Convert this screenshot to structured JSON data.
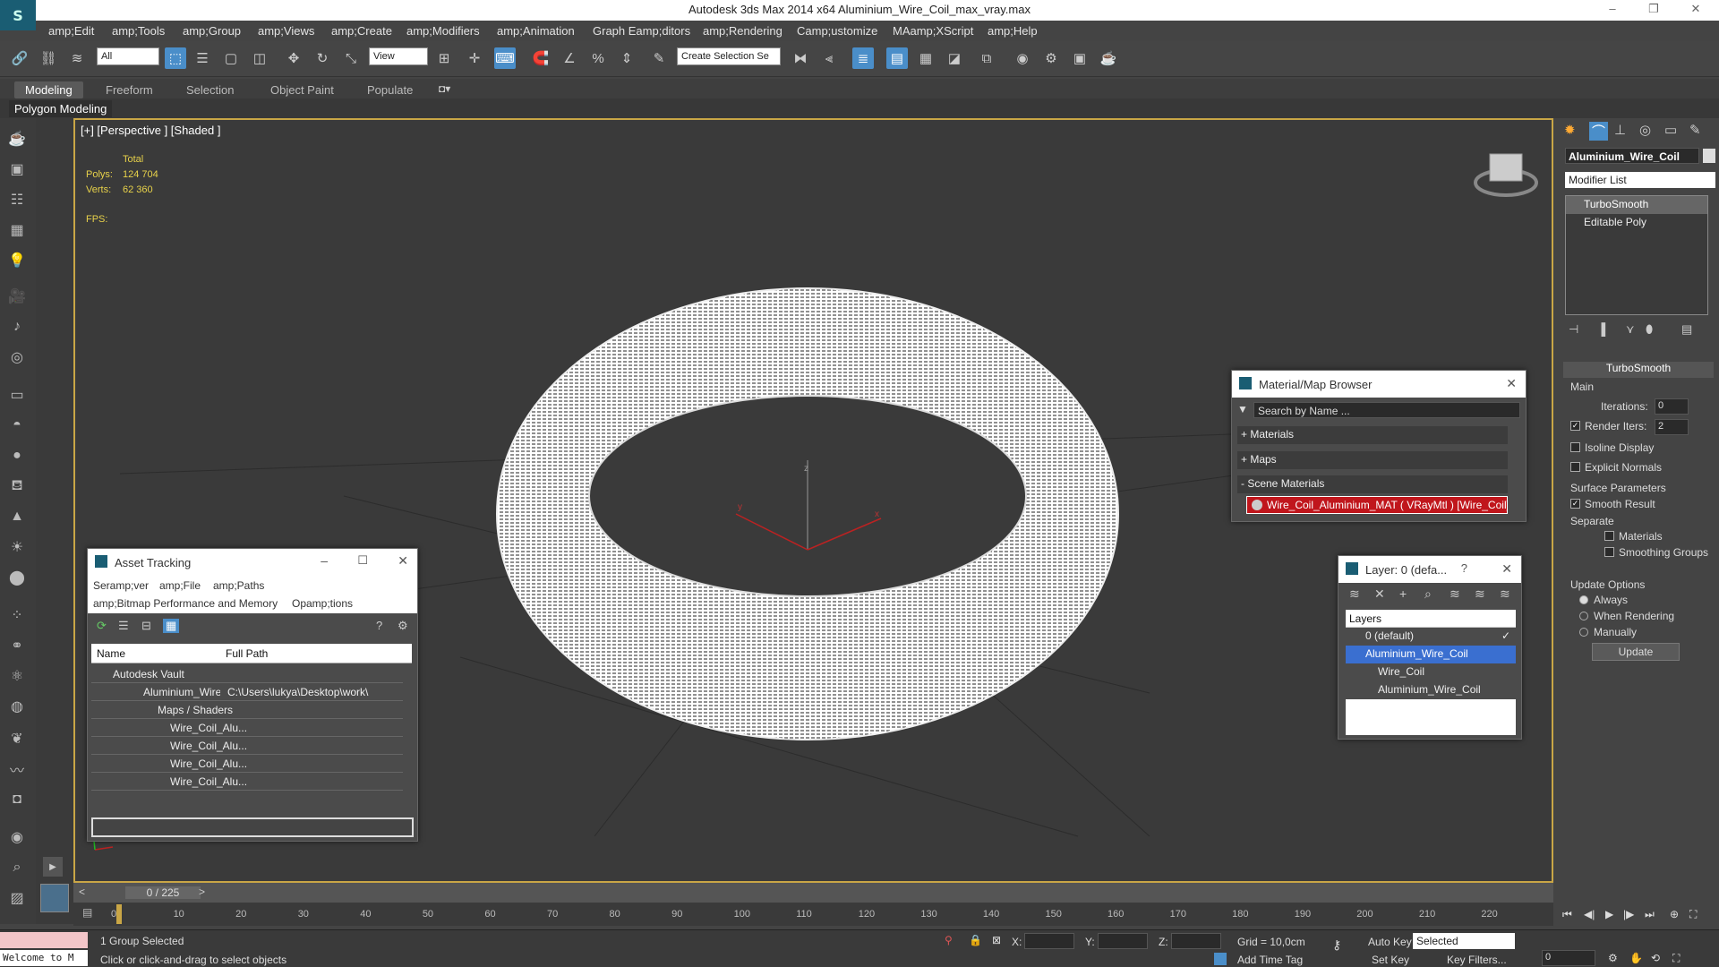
{
  "window": {
    "title": "Autodesk 3ds Max  2014 x64     Aluminium_Wire_Coil_max_vray.max",
    "app_icon": "3ds-max-logo-icon",
    "controls": [
      "–",
      "❐",
      "✕"
    ]
  },
  "menu": [
    "amp;Edit",
    "amp;Tools",
    "amp;Group",
    "amp;Views",
    "amp;Create",
    "amp;Modifiers",
    "amp;Animation",
    "Graph Eamp;ditors",
    "amp;Rendering",
    "Camp;ustomize",
    "MAamp;XScript",
    "amp;Help"
  ],
  "toolbar": {
    "selection_filter": "All",
    "reference_coord": "View",
    "named_selection": "Create Selection Se"
  },
  "ribbon": {
    "tabs": [
      "Modeling",
      "Freeform",
      "Selection",
      "Object Paint",
      "Populate"
    ],
    "active_tab": "Modeling",
    "sub_label": "Polygon Modeling"
  },
  "viewport": {
    "label": "[+] [Perspective ] [Shaded ]",
    "stats": {
      "total_label": "Total",
      "polys_label": "Polys:",
      "polys_value": "124 704",
      "verts_label": "Verts:",
      "verts_value": "62 360",
      "fps_label": "FPS:"
    },
    "axis_x": "x",
    "axis_y": "y",
    "axis_z": "z"
  },
  "command_panel": {
    "object_name": "Aluminium_Wire_Coil",
    "modifier_list": "Modifier List",
    "stack": [
      "TurboSmooth",
      "Editable Poly"
    ],
    "rollout_title": "TurboSmooth",
    "main_label": "Main",
    "iterations_label": "Iterations:",
    "iterations_value": "0",
    "render_iters_label": "Render Iters:",
    "render_iters_value": "2",
    "render_iters_checked": true,
    "isoline_label": "Isoline Display",
    "explicit_normals_label": "Explicit Normals",
    "surface_params_label": "Surface Parameters",
    "smooth_result_label": "Smooth Result",
    "smooth_result_checked": true,
    "separate_label": "Separate",
    "materials_label": "Materials",
    "smoothing_groups_label": "Smoothing Groups",
    "update_options_label": "Update Options",
    "always_label": "Always",
    "when_rendering_label": "When Rendering",
    "manually_label": "Manually",
    "update_button": "Update"
  },
  "material_browser": {
    "title": "Material/Map Browser",
    "search_placeholder": "Search by Name ...",
    "sections": [
      "+ Materials",
      "+ Maps",
      "- Scene Materials"
    ],
    "scene_material": "Wire_Coil_Aluminium_MAT  ( VRayMtl )  [Wire_Coil]"
  },
  "layer_window": {
    "title": "Layer: 0 (defa...",
    "help": "?",
    "header": "Layers",
    "rows": [
      "0 (default)",
      "Aluminium_Wire_Coil",
      "Wire_Coil",
      "Aluminium_Wire_Coil"
    ]
  },
  "asset_tracking": {
    "title": "Asset Tracking",
    "menu": [
      "Seramp;ver",
      "amp;File",
      "amp;Paths",
      "amp;Bitmap Performance and Memory",
      "Opamp;tions"
    ],
    "col_name": "Name",
    "col_path": "Full Path",
    "rows": [
      {
        "name": "Autodesk Vault",
        "path": ""
      },
      {
        "name": "Aluminium_Wire_C...",
        "path": "C:\\Users\\lukya\\Desktop\\work\\"
      },
      {
        "name": "Maps / Shaders",
        "path": ""
      },
      {
        "name": "Wire_Coil_Alu...",
        "path": ""
      },
      {
        "name": "Wire_Coil_Alu...",
        "path": ""
      },
      {
        "name": "Wire_Coil_Alu...",
        "path": ""
      },
      {
        "name": "Wire_Coil_Alu...",
        "path": ""
      }
    ]
  },
  "timeline": {
    "frame_display": "0 / 225",
    "ticks": [
      "0",
      "10",
      "20",
      "30",
      "40",
      "50",
      "60",
      "70",
      "80",
      "90",
      "100",
      "110",
      "120",
      "130",
      "140",
      "150",
      "160",
      "170",
      "180",
      "190",
      "200",
      "210",
      "220"
    ]
  },
  "status": {
    "maxscript_listener": "Welcome to M",
    "selection": "1 Group Selected",
    "prompt": "Click or click-and-drag to select objects",
    "x_label": "X:",
    "y_label": "Y:",
    "z_label": "Z:",
    "grid": "Grid = 10,0cm",
    "add_time_tag": "Add Time Tag",
    "auto_key": "Auto Key",
    "set_key": "Set Key",
    "key_mode": "Selected",
    "key_filters": "Key Filters...",
    "frame_value": "0"
  },
  "colors": {
    "accent_blue": "#4a8ec9",
    "viewport_border": "#c9a646",
    "material_red": "#c0161c",
    "stats_yellow": "#e8d24a"
  }
}
